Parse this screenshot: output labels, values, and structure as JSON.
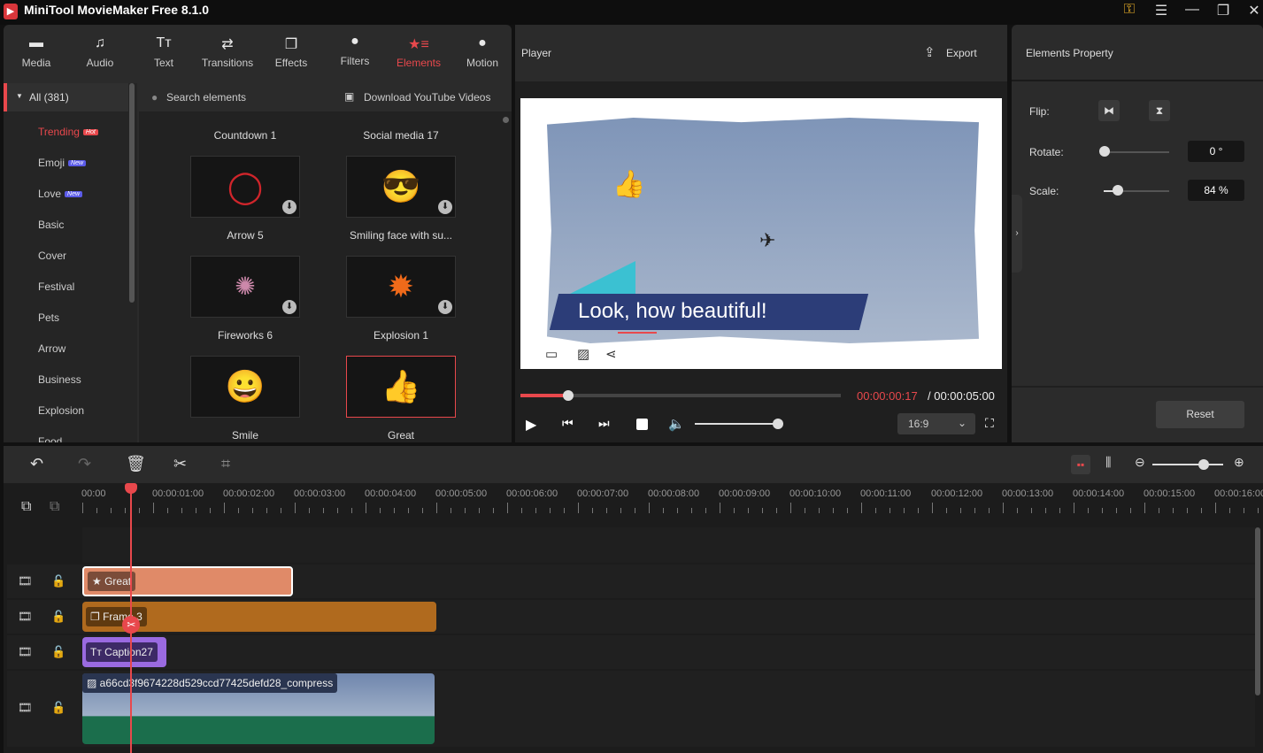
{
  "app": {
    "title": "MiniTool MovieMaker Free 8.1.0"
  },
  "tabs": [
    {
      "label": "Media",
      "icon": "folder-icon"
    },
    {
      "label": "Audio",
      "icon": "music-icon"
    },
    {
      "label": "Text",
      "icon": "text-icon"
    },
    {
      "label": "Transitions",
      "icon": "transitions-icon"
    },
    {
      "label": "Effects",
      "icon": "effects-icon"
    },
    {
      "label": "Filters",
      "icon": "filters-icon"
    },
    {
      "label": "Elements",
      "icon": "elements-icon",
      "active": true
    },
    {
      "label": "Motion",
      "icon": "motion-icon"
    }
  ],
  "categories": {
    "all": "All (381)",
    "items": [
      {
        "label": "Trending",
        "badge": "Hot"
      },
      {
        "label": "Emoji",
        "badge": "New"
      },
      {
        "label": "Love",
        "badge": "New"
      },
      {
        "label": "Basic"
      },
      {
        "label": "Cover"
      },
      {
        "label": "Festival"
      },
      {
        "label": "Pets"
      },
      {
        "label": "Arrow"
      },
      {
        "label": "Business"
      },
      {
        "label": "Explosion"
      },
      {
        "label": "Food"
      }
    ]
  },
  "search": {
    "placeholder": "Search elements",
    "download": "Download YouTube Videos"
  },
  "grid": {
    "headers": [
      "Countdown 1",
      "Social media 17"
    ],
    "items": [
      {
        "label": "Arrow 5"
      },
      {
        "label": "Smiling face with su..."
      },
      {
        "label": "Fireworks 6"
      },
      {
        "label": "Explosion 1"
      },
      {
        "label": "Smile"
      },
      {
        "label": "Great",
        "selected": true
      }
    ]
  },
  "player": {
    "title": "Player",
    "export": "Export",
    "caption": "Look, how beautiful!",
    "current_time": "00:00:00:17",
    "total_time": "/ 00:00:05:00",
    "progress_percent": 15,
    "volume_percent": 100,
    "aspect": "16:9"
  },
  "props": {
    "title": "Elements Property",
    "flip": "Flip:",
    "rotate": "Rotate:",
    "rotate_value": "0 °",
    "scale": "Scale:",
    "scale_value": "84 %",
    "scale_percent": 84,
    "reset": "Reset"
  },
  "timeline": {
    "ticks": [
      "00:00",
      "00:00:01:00",
      "00:00:02:00",
      "00:00:03:00",
      "00:00:04:00",
      "00:00:05:00",
      "00:00:06:00",
      "00:00:07:00",
      "00:00:08:00",
      "00:00:09:00",
      "00:00:10:00",
      "00:00:11:00",
      "00:00:12:00",
      "00:00:13:00",
      "00:00:14:00",
      "00:00:15:00",
      "00:00:16:00"
    ],
    "clips": {
      "great": "Great",
      "frame": "Frame 3",
      "caption": "Caption27",
      "image": "a66cd3f9674228d529ccd77425defd28_compress"
    },
    "colors": {
      "great": "#e08a68",
      "frame": "#b06a1e",
      "caption": "#9a6ae0",
      "accent": "#e8484c"
    }
  }
}
